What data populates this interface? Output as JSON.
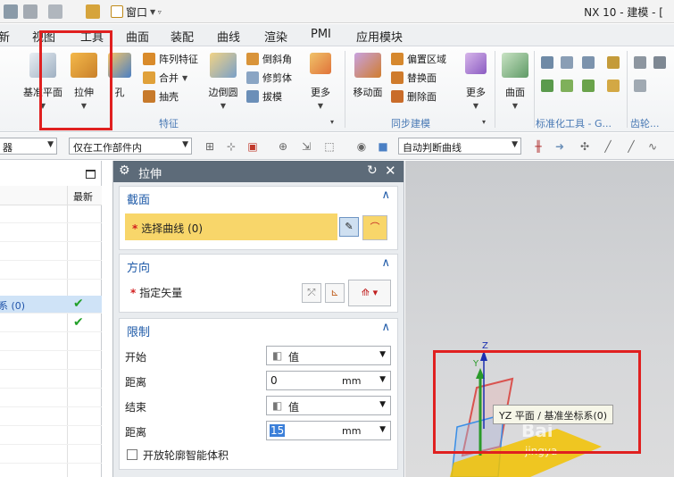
{
  "titlebar": {
    "window_menu": "窗口",
    "title": "NX 10 - 建模 - ["
  },
  "menu_tabs": [
    "新",
    "视图",
    "工具",
    "曲面",
    "装配",
    "曲线",
    "渲染",
    "PMI",
    "应用模块"
  ],
  "ribbon": {
    "datum_plane": "基准平面",
    "extrude": "拉伸",
    "hole": "孔",
    "pattern_feature": "阵列特征",
    "unite": "合并",
    "shell": "抽壳",
    "edge_blend": "边倒圆",
    "chamfer": "倒斜角",
    "trim_body": "修剪体",
    "draft": "拔模",
    "more_1": "更多",
    "feature_group": "特征",
    "move_face": "移动面",
    "offset_region": "偏置区域",
    "replace_face": "替换面",
    "delete_face": "删除面",
    "more_2": "更多",
    "sync_group": "同步建模",
    "surface": "曲面",
    "standard_tools_group": "标准化工具 - G...",
    "gear_group": "齿轮..."
  },
  "selection_bar": {
    "filter_value": "器",
    "scope_value": "仅在工作部件内",
    "curve_rule": "自动判断曲线"
  },
  "navigator": {
    "column_latest": "最新",
    "selected_row_label": "系 (0)",
    "check_icon": "check-icon"
  },
  "dialog": {
    "title": "拉伸",
    "section_profile": {
      "title": "截面",
      "select_curve": "选择曲线 (0)"
    },
    "section_direction": {
      "title": "方向",
      "specify_vector": "指定矢量"
    },
    "section_limits": {
      "title": "限制",
      "start_label": "开始",
      "start_value": "值",
      "start_distance_label": "距离",
      "start_distance": "0",
      "start_unit": "mm",
      "end_label": "结束",
      "end_value": "值",
      "end_distance_label": "距离",
      "end_distance": "15",
      "end_unit": "mm",
      "open_profile_smart_volume": "开放轮廓智能体积"
    }
  },
  "viewport": {
    "axis_z": "Z",
    "axis_y": "Y",
    "tooltip": "YZ 平面 / 基准坐标系(0)",
    "watermark_1": "Bai",
    "watermark_2": "jingya"
  },
  "colors": {
    "highlight_red": "#e02020",
    "selection_yellow": "#f8d66a",
    "dialog_title": "#5d6b79",
    "section_title": "#1e5aa8"
  }
}
